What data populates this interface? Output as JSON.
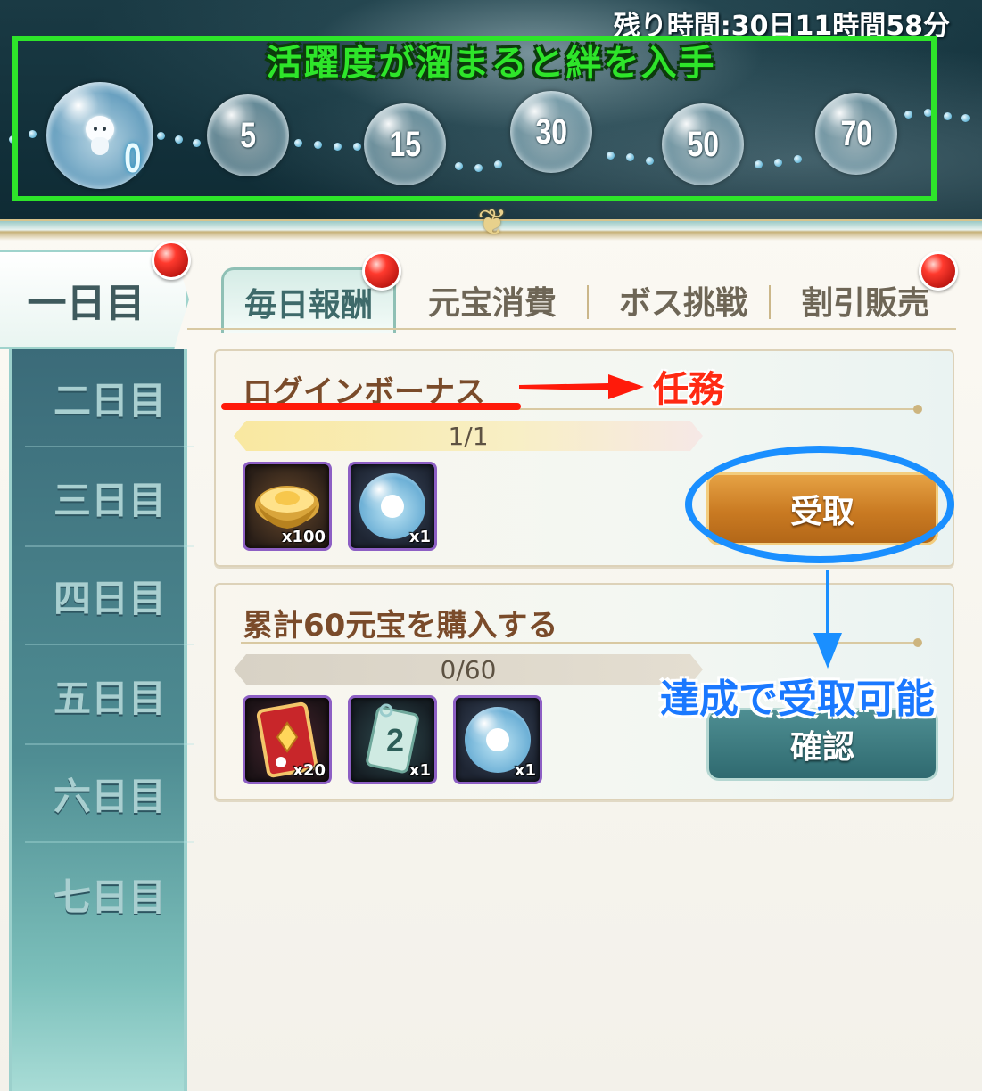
{
  "banner": {
    "remaining_time": "残り時間:30日11時間58分",
    "caption": "活躍度が溜まると絆を入手",
    "milestones": [
      "0",
      "5",
      "15",
      "30",
      "50",
      "70"
    ]
  },
  "sidebar": {
    "days": [
      "一日目",
      "二日目",
      "三日目",
      "四日目",
      "五日目",
      "六日目",
      "七日目"
    ],
    "selected": "一日目"
  },
  "tabs": [
    "毎日報酬",
    "元宝消費",
    "ボス挑戦",
    "割引販売"
  ],
  "tasks": [
    {
      "title": "ログインボーナス",
      "progress": "1/1",
      "progress_fraction": 1.0,
      "rewards": [
        {
          "icon": "gold-ingot-icon",
          "qty": "x100"
        },
        {
          "icon": "spirit-bubble-icon",
          "qty": "x1"
        }
      ],
      "button": "受取"
    },
    {
      "title": "累計60元宝を購入する",
      "progress": "0/60",
      "progress_fraction": 0.0,
      "rewards": [
        {
          "icon": "red-card-icon",
          "qty": "x20"
        },
        {
          "icon": "ticket-2-icon",
          "qty": "x1"
        },
        {
          "icon": "spirit-bubble-icon",
          "qty": "x1"
        }
      ],
      "button": "確認"
    }
  ],
  "annotations": {
    "task_label": "任務",
    "achieve_label": "達成で受取可能"
  },
  "colors": {
    "annotation_green": "#2ee52a",
    "annotation_red": "#ff1a0a",
    "annotation_blue": "#1a8fff",
    "receive_button": "#c97a22",
    "confirm_button": "#2f6a70"
  }
}
